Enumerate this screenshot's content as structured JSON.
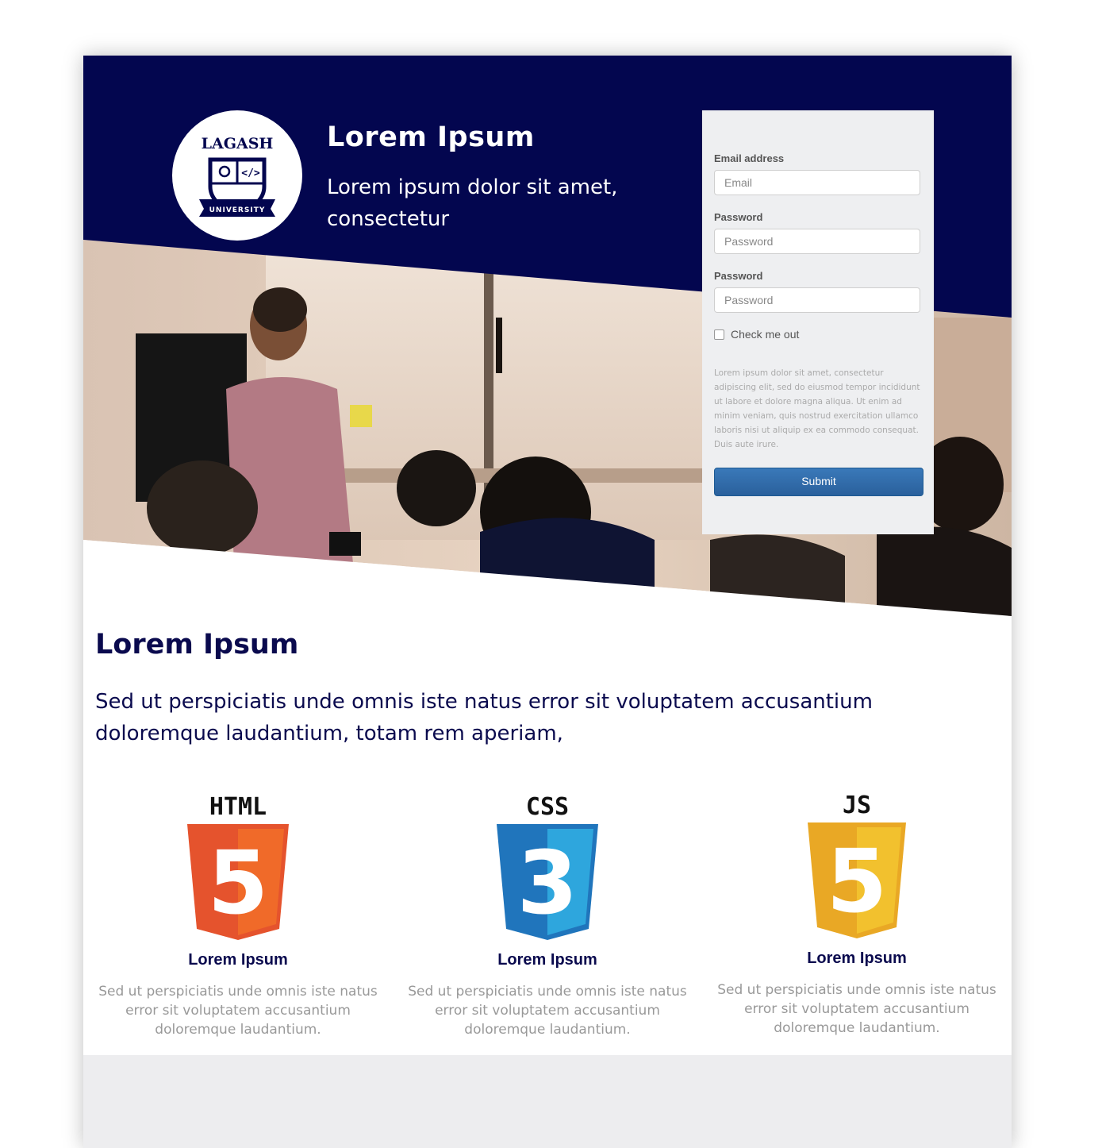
{
  "colors": {
    "navy": "#03064f",
    "form_bg": "#eeeff1",
    "submit_blue": "#2f6aa7",
    "footer_gray": "#ededef",
    "html_orange": "#e5532d",
    "css_blue": "#2075bc",
    "js_yellow": "#e9a825"
  },
  "hero": {
    "logo": {
      "top_text": "LAGASH",
      "banner_text": "UNIVERSITY"
    },
    "title": "Lorem Ipsum",
    "subtitle": "Lorem ipsum dolor sit amet, consectetur"
  },
  "form": {
    "email_label": "Email address",
    "email_placeholder": "Email",
    "password_label_1": "Password",
    "password_placeholder_1": "Password",
    "password_label_2": "Password",
    "password_placeholder_2": "Password",
    "checkbox_label": "Check me out",
    "checkbox_checked": false,
    "fine_print": "Lorem ipsum dolor sit amet, consectetur adipiscing elit, sed do eiusmod tempor incididunt ut labore et dolore magna aliqua. Ut enim ad minim veniam, quis nostrud exercitation ullamco laboris nisi ut aliquip ex ea commodo consequat. Duis aute irure.",
    "submit_label": "Submit"
  },
  "content": {
    "title": "Lorem Ipsum",
    "text": "Sed ut perspiciatis unde omnis iste natus error sit voluptatem accusantium doloremque laudantium, totam rem aperiam,"
  },
  "features": [
    {
      "badge_label": "HTML",
      "badge_number": "5",
      "icon": "html5-shield-icon",
      "title": "Lorem Ipsum",
      "text": "Sed ut perspiciatis unde omnis iste natus error sit voluptatem accusantium doloremque laudantium."
    },
    {
      "badge_label": "CSS",
      "badge_number": "3",
      "icon": "css3-shield-icon",
      "title": "Lorem Ipsum",
      "text": "Sed ut perspiciatis unde omnis iste natus error sit voluptatem accusantium doloremque laudantium."
    },
    {
      "badge_label": "JS",
      "badge_number": "5",
      "icon": "js-shield-icon",
      "title": "Lorem Ipsum",
      "text": "Sed ut perspiciatis unde omnis iste natus error sit voluptatem accusantium doloremque laudantium."
    }
  ]
}
